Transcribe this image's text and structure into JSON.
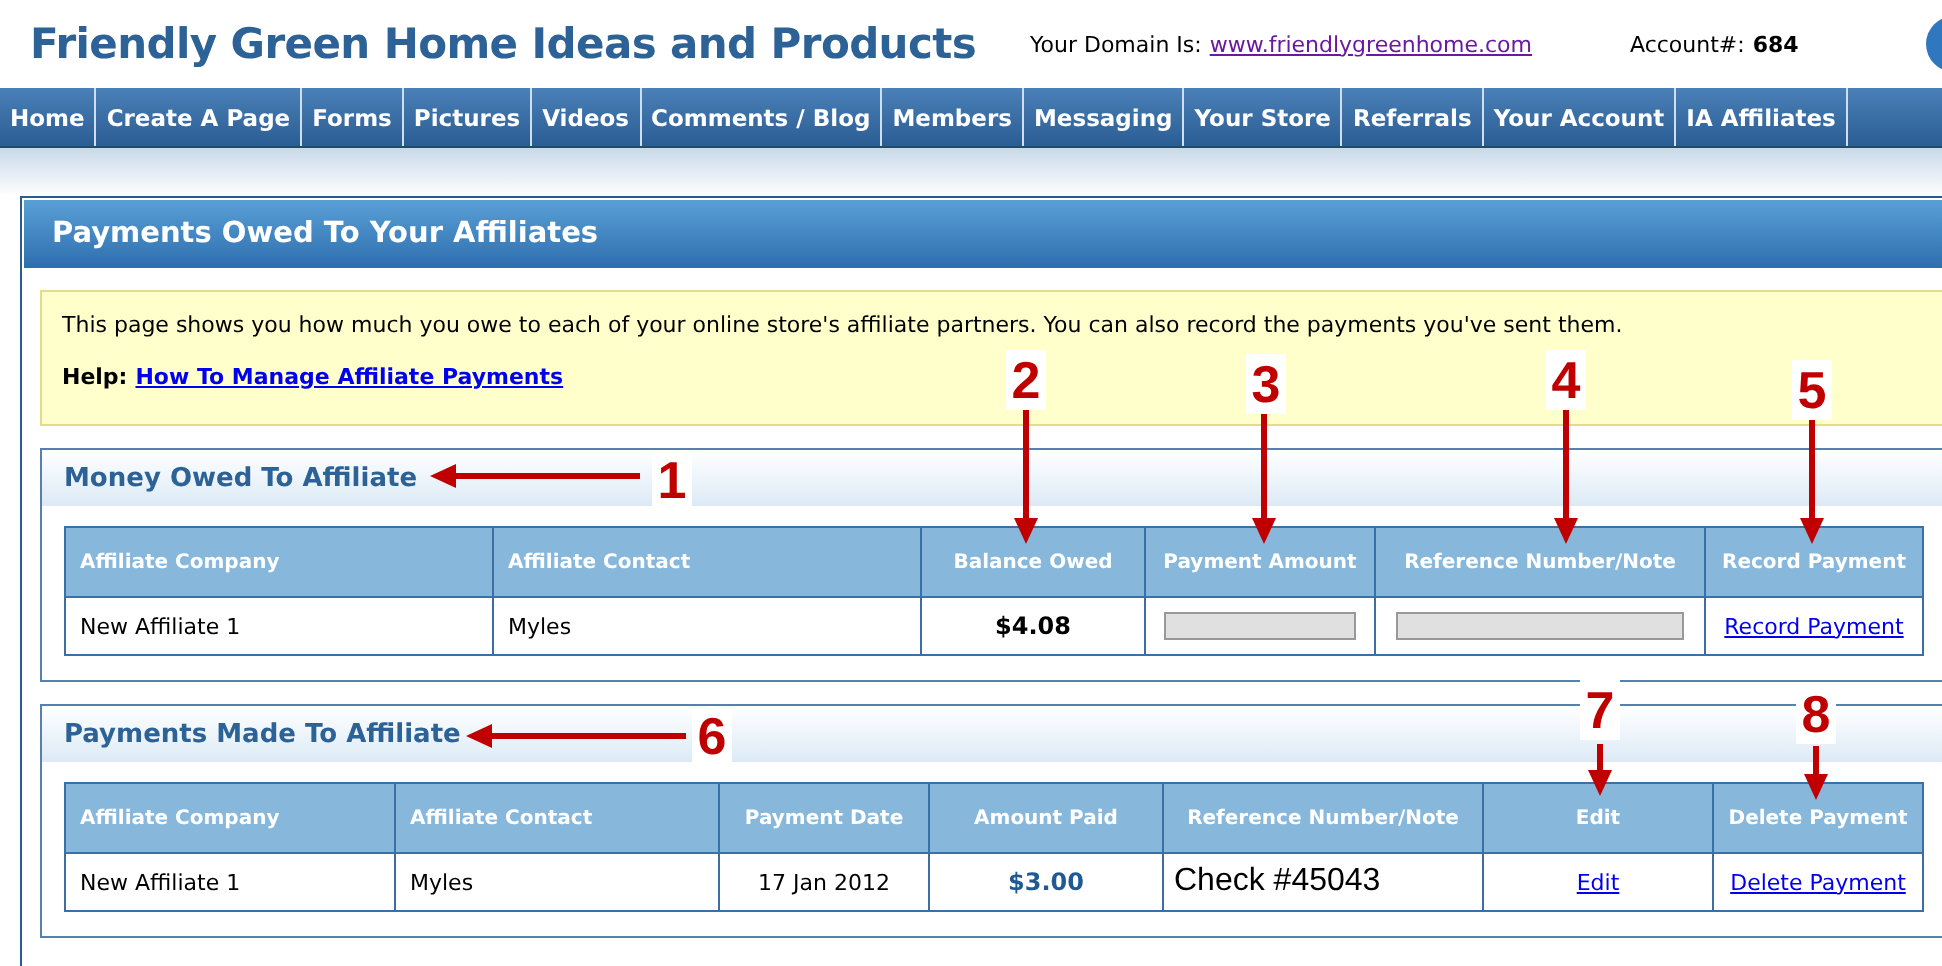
{
  "site_title": "Friendly Green Home Ideas and Products",
  "domain": {
    "label": "Your Domain Is:",
    "link": "www.friendlygreenhome.com"
  },
  "account": {
    "label": "Account#:",
    "value": "684"
  },
  "nav": [
    {
      "label": "Home"
    },
    {
      "label": "Create A Page"
    },
    {
      "label": "Forms"
    },
    {
      "label": "Pictures"
    },
    {
      "label": "Videos"
    },
    {
      "label": "Comments / Blog"
    },
    {
      "label": "Members"
    },
    {
      "label": "Messaging"
    },
    {
      "label": "Your Store"
    },
    {
      "label": "Referrals"
    },
    {
      "label": "Your Account"
    },
    {
      "label": "IA Affiliates"
    }
  ],
  "panel_title": "Payments Owed To Your Affiliates",
  "info": {
    "text": "This page shows you how much you owe to each of your online store's affiliate partners. You can also record the payments you've sent them.",
    "help_label": "Help:",
    "help_link": "How To Manage Affiliate Payments"
  },
  "sections": [
    {
      "title": "Money Owed To Affiliate",
      "columns": [
        {
          "label": "Affiliate Company"
        },
        {
          "label": "Affiliate Contact"
        },
        {
          "label": "Balance Owed"
        },
        {
          "label": "Payment Amount"
        },
        {
          "label": "Reference Number/Note"
        },
        {
          "label": "Record Payment"
        }
      ],
      "rows": [
        [
          {
            "kind": "text",
            "text": "New Affiliate 1"
          },
          {
            "kind": "text",
            "text": "Myles"
          },
          {
            "kind": "money",
            "text": "$4.08"
          },
          {
            "kind": "input"
          },
          {
            "kind": "input"
          },
          {
            "kind": "link",
            "text": "Record Payment"
          }
        ]
      ]
    },
    {
      "title": "Payments Made To Affiliate",
      "columns": [
        {
          "label": "Affiliate Company"
        },
        {
          "label": "Affiliate Contact"
        },
        {
          "label": "Payment Date"
        },
        {
          "label": "Amount Paid"
        },
        {
          "label": "Reference Number/Note"
        },
        {
          "label": "Edit"
        },
        {
          "label": "Delete Payment"
        }
      ],
      "rows": [
        [
          {
            "kind": "text",
            "text": "New Affiliate 1"
          },
          {
            "kind": "text",
            "text": "Myles"
          },
          {
            "kind": "date",
            "text": "17 Jan 2012"
          },
          {
            "kind": "paid",
            "text": "$3.00"
          },
          {
            "kind": "note",
            "text": "Check #45043"
          },
          {
            "kind": "link",
            "text": "Edit"
          },
          {
            "kind": "link",
            "text": "Delete Payment"
          }
        ]
      ]
    }
  ],
  "annotations": [
    {
      "label": "1"
    },
    {
      "label": "2"
    },
    {
      "label": "3"
    },
    {
      "label": "4"
    },
    {
      "label": "5"
    },
    {
      "label": "6"
    },
    {
      "label": "7"
    },
    {
      "label": "8"
    }
  ]
}
